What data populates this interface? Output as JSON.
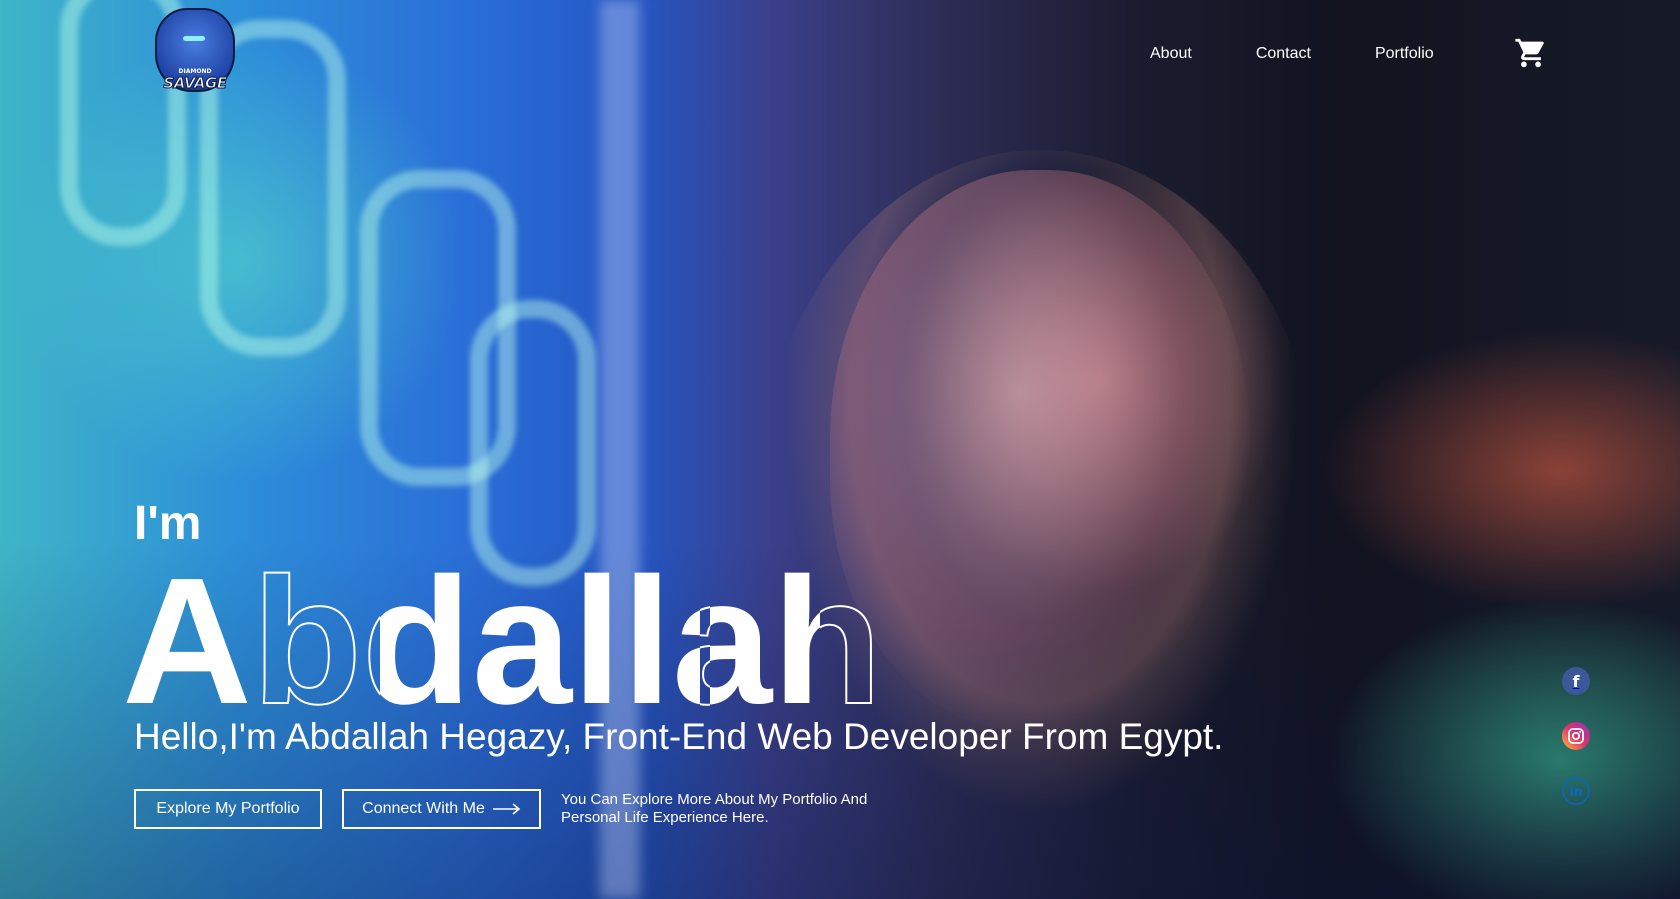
{
  "header": {
    "logo": {
      "top_text": "DIAMOND",
      "main_text": "SAVAGE",
      "icon": "bear-mascot-icon"
    },
    "nav": [
      {
        "label": "About"
      },
      {
        "label": "Contact"
      },
      {
        "label": "Portfolio"
      }
    ],
    "cart_icon": "cart-icon"
  },
  "hero": {
    "intro": "I'm",
    "name": "Abdallah",
    "subtitle": "Hello,I'm Abdallah Hegazy, Front-End Web Developer From Egypt.",
    "buttons": {
      "primary_label": "Explore My Portfolio",
      "secondary_label": "Connect With Me"
    },
    "note": "You Can Explore More About My Portfolio And Personal Life Experience Here."
  },
  "social": [
    {
      "name": "facebook",
      "icon": "facebook-icon",
      "glyph": "f",
      "color": "#3b5998"
    },
    {
      "name": "instagram",
      "icon": "instagram-icon",
      "color": "#e1306c"
    },
    {
      "name": "linkedin",
      "icon": "linkedin-icon",
      "glyph": "in",
      "color": "#0a66c2"
    }
  ]
}
